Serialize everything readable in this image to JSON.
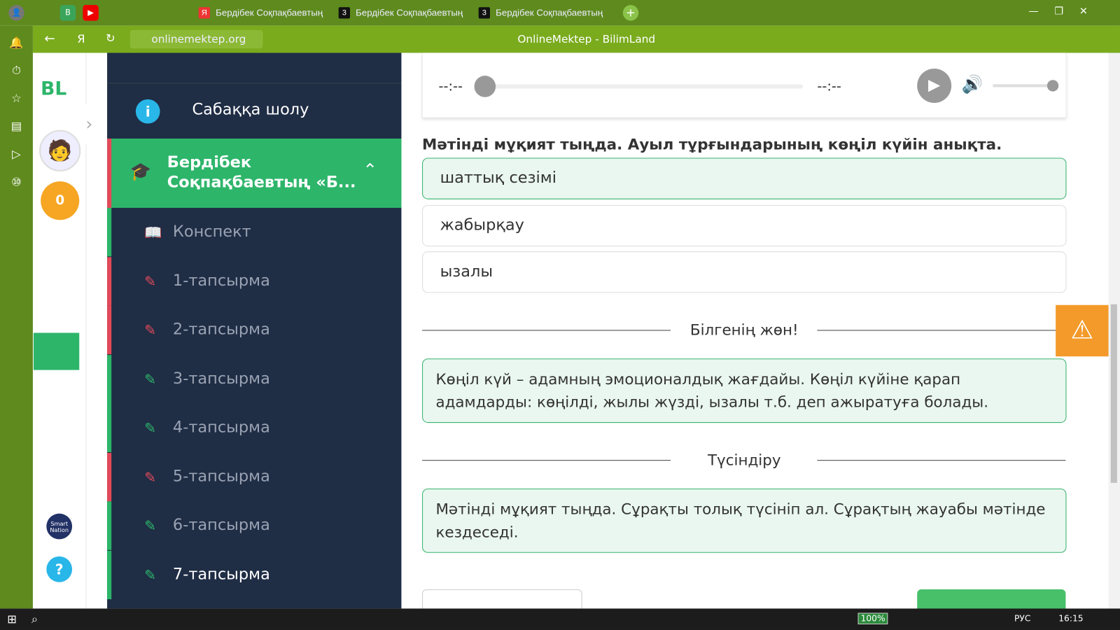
{
  "browser": {
    "tabs": [
      {
        "label": "Бердібек Соқпақбаевтың"
      },
      {
        "label": "Бердібек Соқпақбаевтың"
      },
      {
        "label": "Бердібек Соқпақбаевтың"
      }
    ],
    "url": "onlinemektep.org",
    "page_title": "OnlineMektep - BilimLand"
  },
  "side": {
    "logo": "BL",
    "score": "0",
    "smart": "Smart Nation",
    "help": "?"
  },
  "nav": {
    "overview": "Сабаққа шолу",
    "current": "Бердібек Соқпақбаевтың «Б...",
    "items": [
      {
        "label": "Конспект"
      },
      {
        "label": "1-тапсырма"
      },
      {
        "label": "2-тапсырма"
      },
      {
        "label": "3-тапсырма"
      },
      {
        "label": "4-тапсырма"
      },
      {
        "label": "5-тапсырма"
      },
      {
        "label": "6-тапсырма"
      },
      {
        "label": "7-тапсырма"
      }
    ]
  },
  "player": {
    "time_current": "--:--",
    "time_total": "--:--",
    "progress": 0,
    "volume": 1
  },
  "question": "Мәтінді мұқият тыңда. Ауыл тұрғындарының көңіл күйін анықта.",
  "options": [
    {
      "label": "шаттық сезімі"
    },
    {
      "label": "жабырқау"
    },
    {
      "label": "ызалы"
    }
  ],
  "know": {
    "title": "Білгенің жөн!",
    "text": "Көңіл күй – адамның эмоционалдық жағдайы. Көңіл күйіне қарап адамдарды: көңілді, жылы жүзді, ызалы т.б. деп ажыратуға болады."
  },
  "explain": {
    "title": "Түсіндіру",
    "text": "Мәтінді мұқият тыңда. Сұрақты толық түсініп ал. Сұрақтың жауабы мәтінде кездеседі."
  },
  "taskbar": {
    "zoom": "100%",
    "lang": "РУС",
    "time": "16:15"
  }
}
